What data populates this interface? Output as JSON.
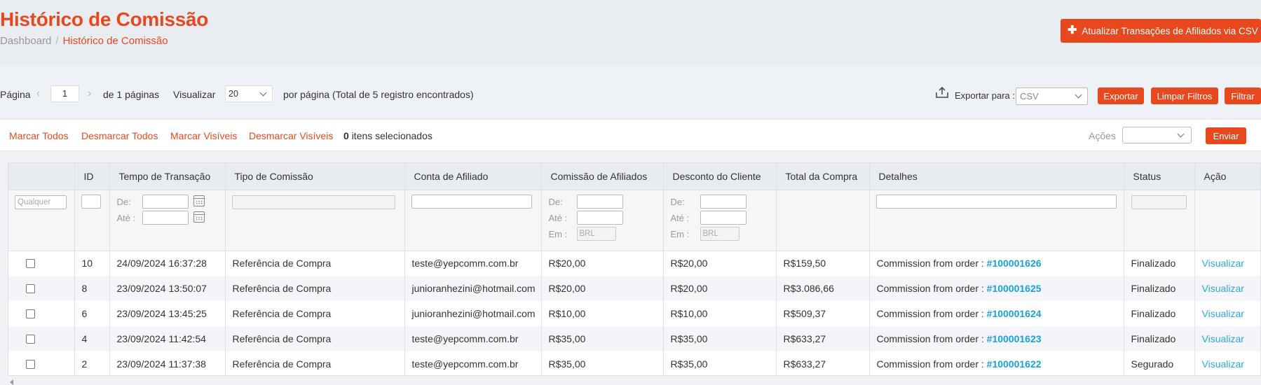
{
  "header": {
    "title": "Histórico de Comissão",
    "breadcrumb": {
      "home": "Dashboard",
      "separator": "/",
      "current": "Histórico de Comissão"
    },
    "csv_button": "Atualizar Transações de Afiliados via CSV"
  },
  "pagination": {
    "page_label": "Página",
    "current_page": "1",
    "of_pages": "de 1 páginas",
    "view_label": "Visualizar",
    "per_page": "20",
    "total_text": "por página (Total de 5 registro encontrados)"
  },
  "export": {
    "label": "Exportar para :",
    "format": "CSV",
    "export_button": "Exportar",
    "clear_button": "Limpar Filtros",
    "filter_button": "Filtrar"
  },
  "selection": {
    "mark_all": "Marcar Todos",
    "unmark_all": "Desmarcar Todos",
    "mark_visible": "Marcar Visíveis",
    "unmark_visible": "Desmarcar Visíveis",
    "count": "0",
    "count_suffix": "itens selecionados",
    "actions_label": "Ações",
    "send_button": "Enviar"
  },
  "grid": {
    "columns": [
      "",
      "ID",
      "Tempo de Transação",
      "Tipo de Comissão",
      "Conta de Afiliado",
      "Comissão de Afiliados",
      "Desconto do Cliente",
      "Total da Compra",
      "Detalhes",
      "Status",
      "Ação"
    ],
    "filters": {
      "any_placeholder": "Qualquer",
      "from_label": "De:",
      "to_label": "Até :",
      "in_label": "Em :",
      "currency": "BRL"
    },
    "details_prefix": "Commission from order : ",
    "rows": [
      {
        "id": "10",
        "time": "24/09/2024 16:37:28",
        "type": "Referência de Compra",
        "account": "teste@yepcomm.com.br",
        "commission": "R$20,00",
        "discount": "R$20,00",
        "total": "R$159,50",
        "order": "#100001626",
        "status": "Finalizado",
        "action": "Visualizar"
      },
      {
        "id": "8",
        "time": "23/09/2024 13:50:07",
        "type": "Referência de Compra",
        "account": "junioranhezini@hotmail.com",
        "commission": "R$20,00",
        "discount": "R$20,00",
        "total": "R$3.086,66",
        "order": "#100001625",
        "status": "Finalizado",
        "action": "Visualizar"
      },
      {
        "id": "6",
        "time": "23/09/2024 13:45:25",
        "type": "Referência de Compra",
        "account": "junioranhezini@hotmail.com",
        "commission": "R$10,00",
        "discount": "R$10,00",
        "total": "R$509,37",
        "order": "#100001624",
        "status": "Finalizado",
        "action": "Visualizar"
      },
      {
        "id": "4",
        "time": "23/09/2024 11:42:54",
        "type": "Referência de Compra",
        "account": "teste@yepcomm.com.br",
        "commission": "R$35,00",
        "discount": "R$35,00",
        "total": "R$633,27",
        "order": "#100001623",
        "status": "Finalizado",
        "action": "Visualizar"
      },
      {
        "id": "2",
        "time": "23/09/2024 11:37:38",
        "type": "Referência de Compra",
        "account": "teste@yepcomm.com.br",
        "commission": "R$35,00",
        "discount": "R$35,00",
        "total": "R$633,27",
        "order": "#100001622",
        "status": "Segurado",
        "action": "Visualizar"
      }
    ]
  },
  "colors": {
    "accent": "#e8481e",
    "link": "#1aa0d8"
  }
}
